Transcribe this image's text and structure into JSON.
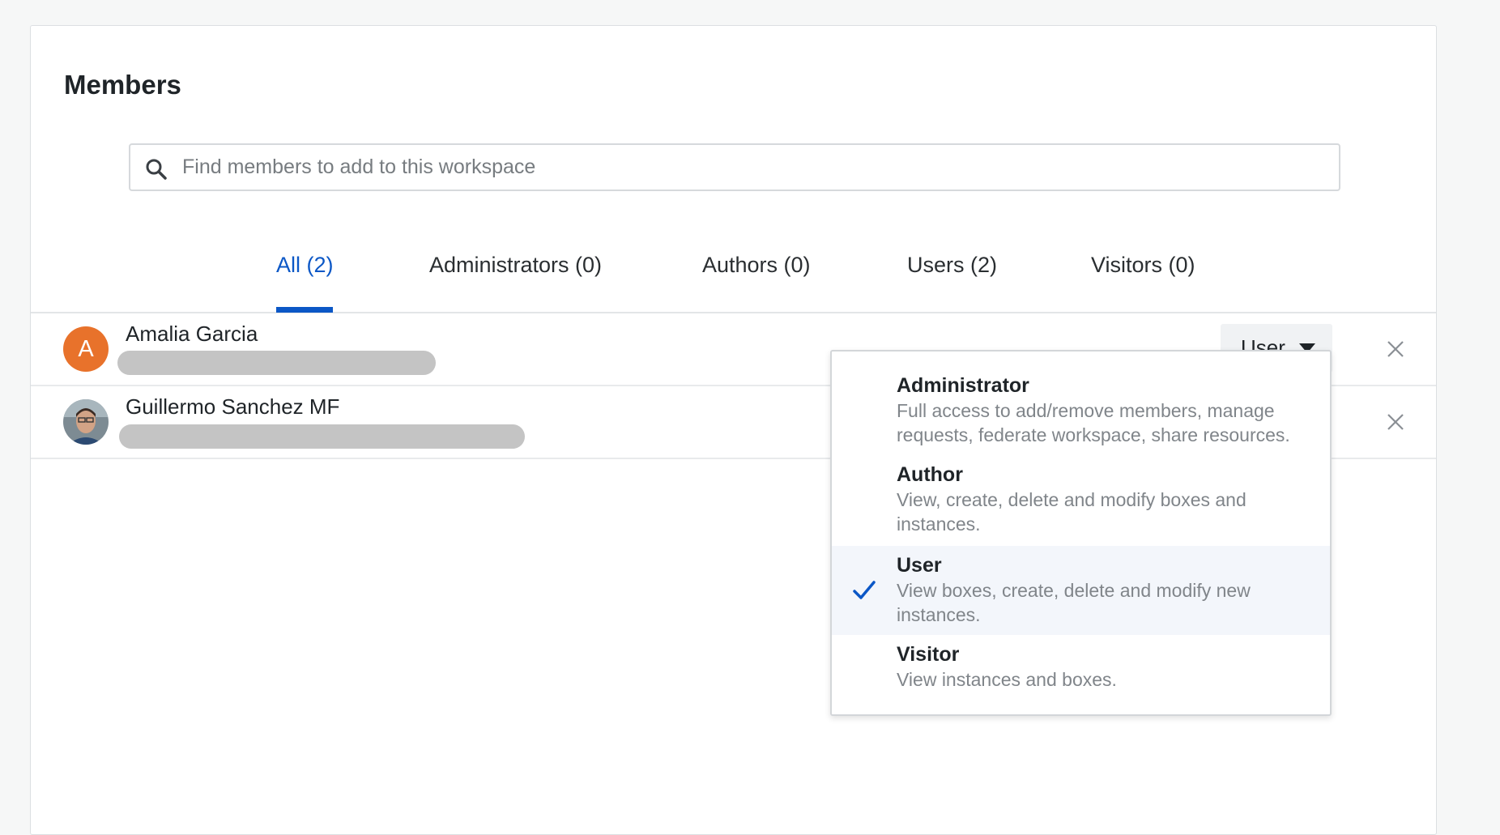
{
  "page": {
    "title": "Members"
  },
  "search": {
    "placeholder": "Find members to add to this workspace",
    "value": "",
    "icon": "search-icon"
  },
  "tabs": [
    {
      "label": "All (2)",
      "active": true
    },
    {
      "label": "Administrators (0)",
      "active": false
    },
    {
      "label": "Authors (0)",
      "active": false
    },
    {
      "label": "Users (2)",
      "active": false
    },
    {
      "label": "Visitors (0)",
      "active": false
    }
  ],
  "members": [
    {
      "name": "Amalia Garcia",
      "avatar_letter": "A",
      "avatar_color": "#e8722b",
      "role": "User",
      "remove_icon": "close-icon"
    },
    {
      "name": "Guillermo Sanchez MF",
      "avatar_letter": "",
      "avatar_type": "photo",
      "remove_icon": "close-icon"
    }
  ],
  "role_dropdown": {
    "options": [
      {
        "title": "Administrator",
        "description": "Full access to add/remove members, manage requests, federate workspace, share resources.",
        "selected": false
      },
      {
        "title": "Author",
        "description": "View, create, delete and modify boxes and instances.",
        "selected": false
      },
      {
        "title": "User",
        "description": "View boxes, create, delete and modify new instances.",
        "selected": true
      },
      {
        "title": "Visitor",
        "description": "View instances and boxes.",
        "selected": false
      }
    ]
  },
  "colors": {
    "accent": "#0b57c6",
    "avatar_orange": "#e8722b",
    "selected_option_bg": "#f3f6fb"
  }
}
